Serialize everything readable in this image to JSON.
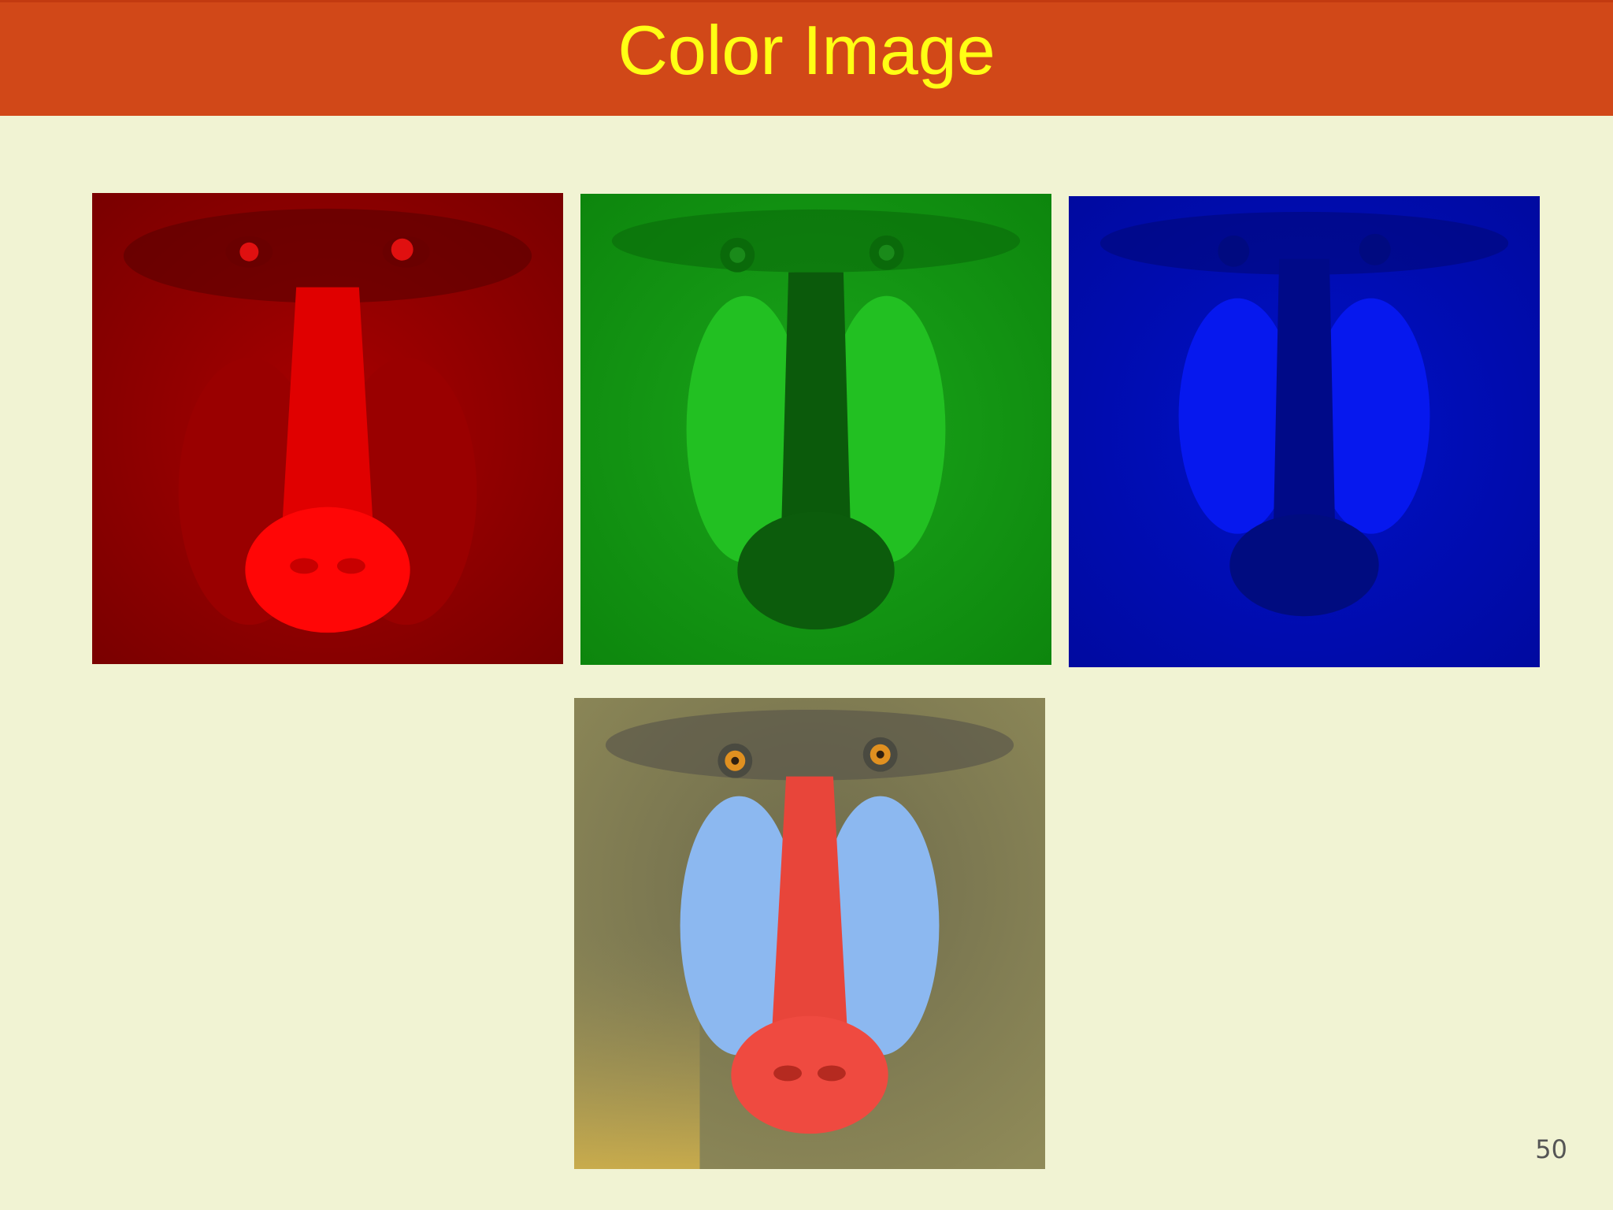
{
  "slide": {
    "title": "Color Image",
    "page_number": "50"
  },
  "colors": {
    "title_bar": "#d14818",
    "title_text": "#ffff14",
    "background": "#f1f3d3"
  },
  "images": [
    {
      "id": "red-channel",
      "icon": "mandrill-red-channel-image"
    },
    {
      "id": "green-channel",
      "icon": "mandrill-green-channel-image"
    },
    {
      "id": "blue-channel",
      "icon": "mandrill-blue-channel-image"
    },
    {
      "id": "full-color",
      "icon": "mandrill-color-image"
    }
  ]
}
